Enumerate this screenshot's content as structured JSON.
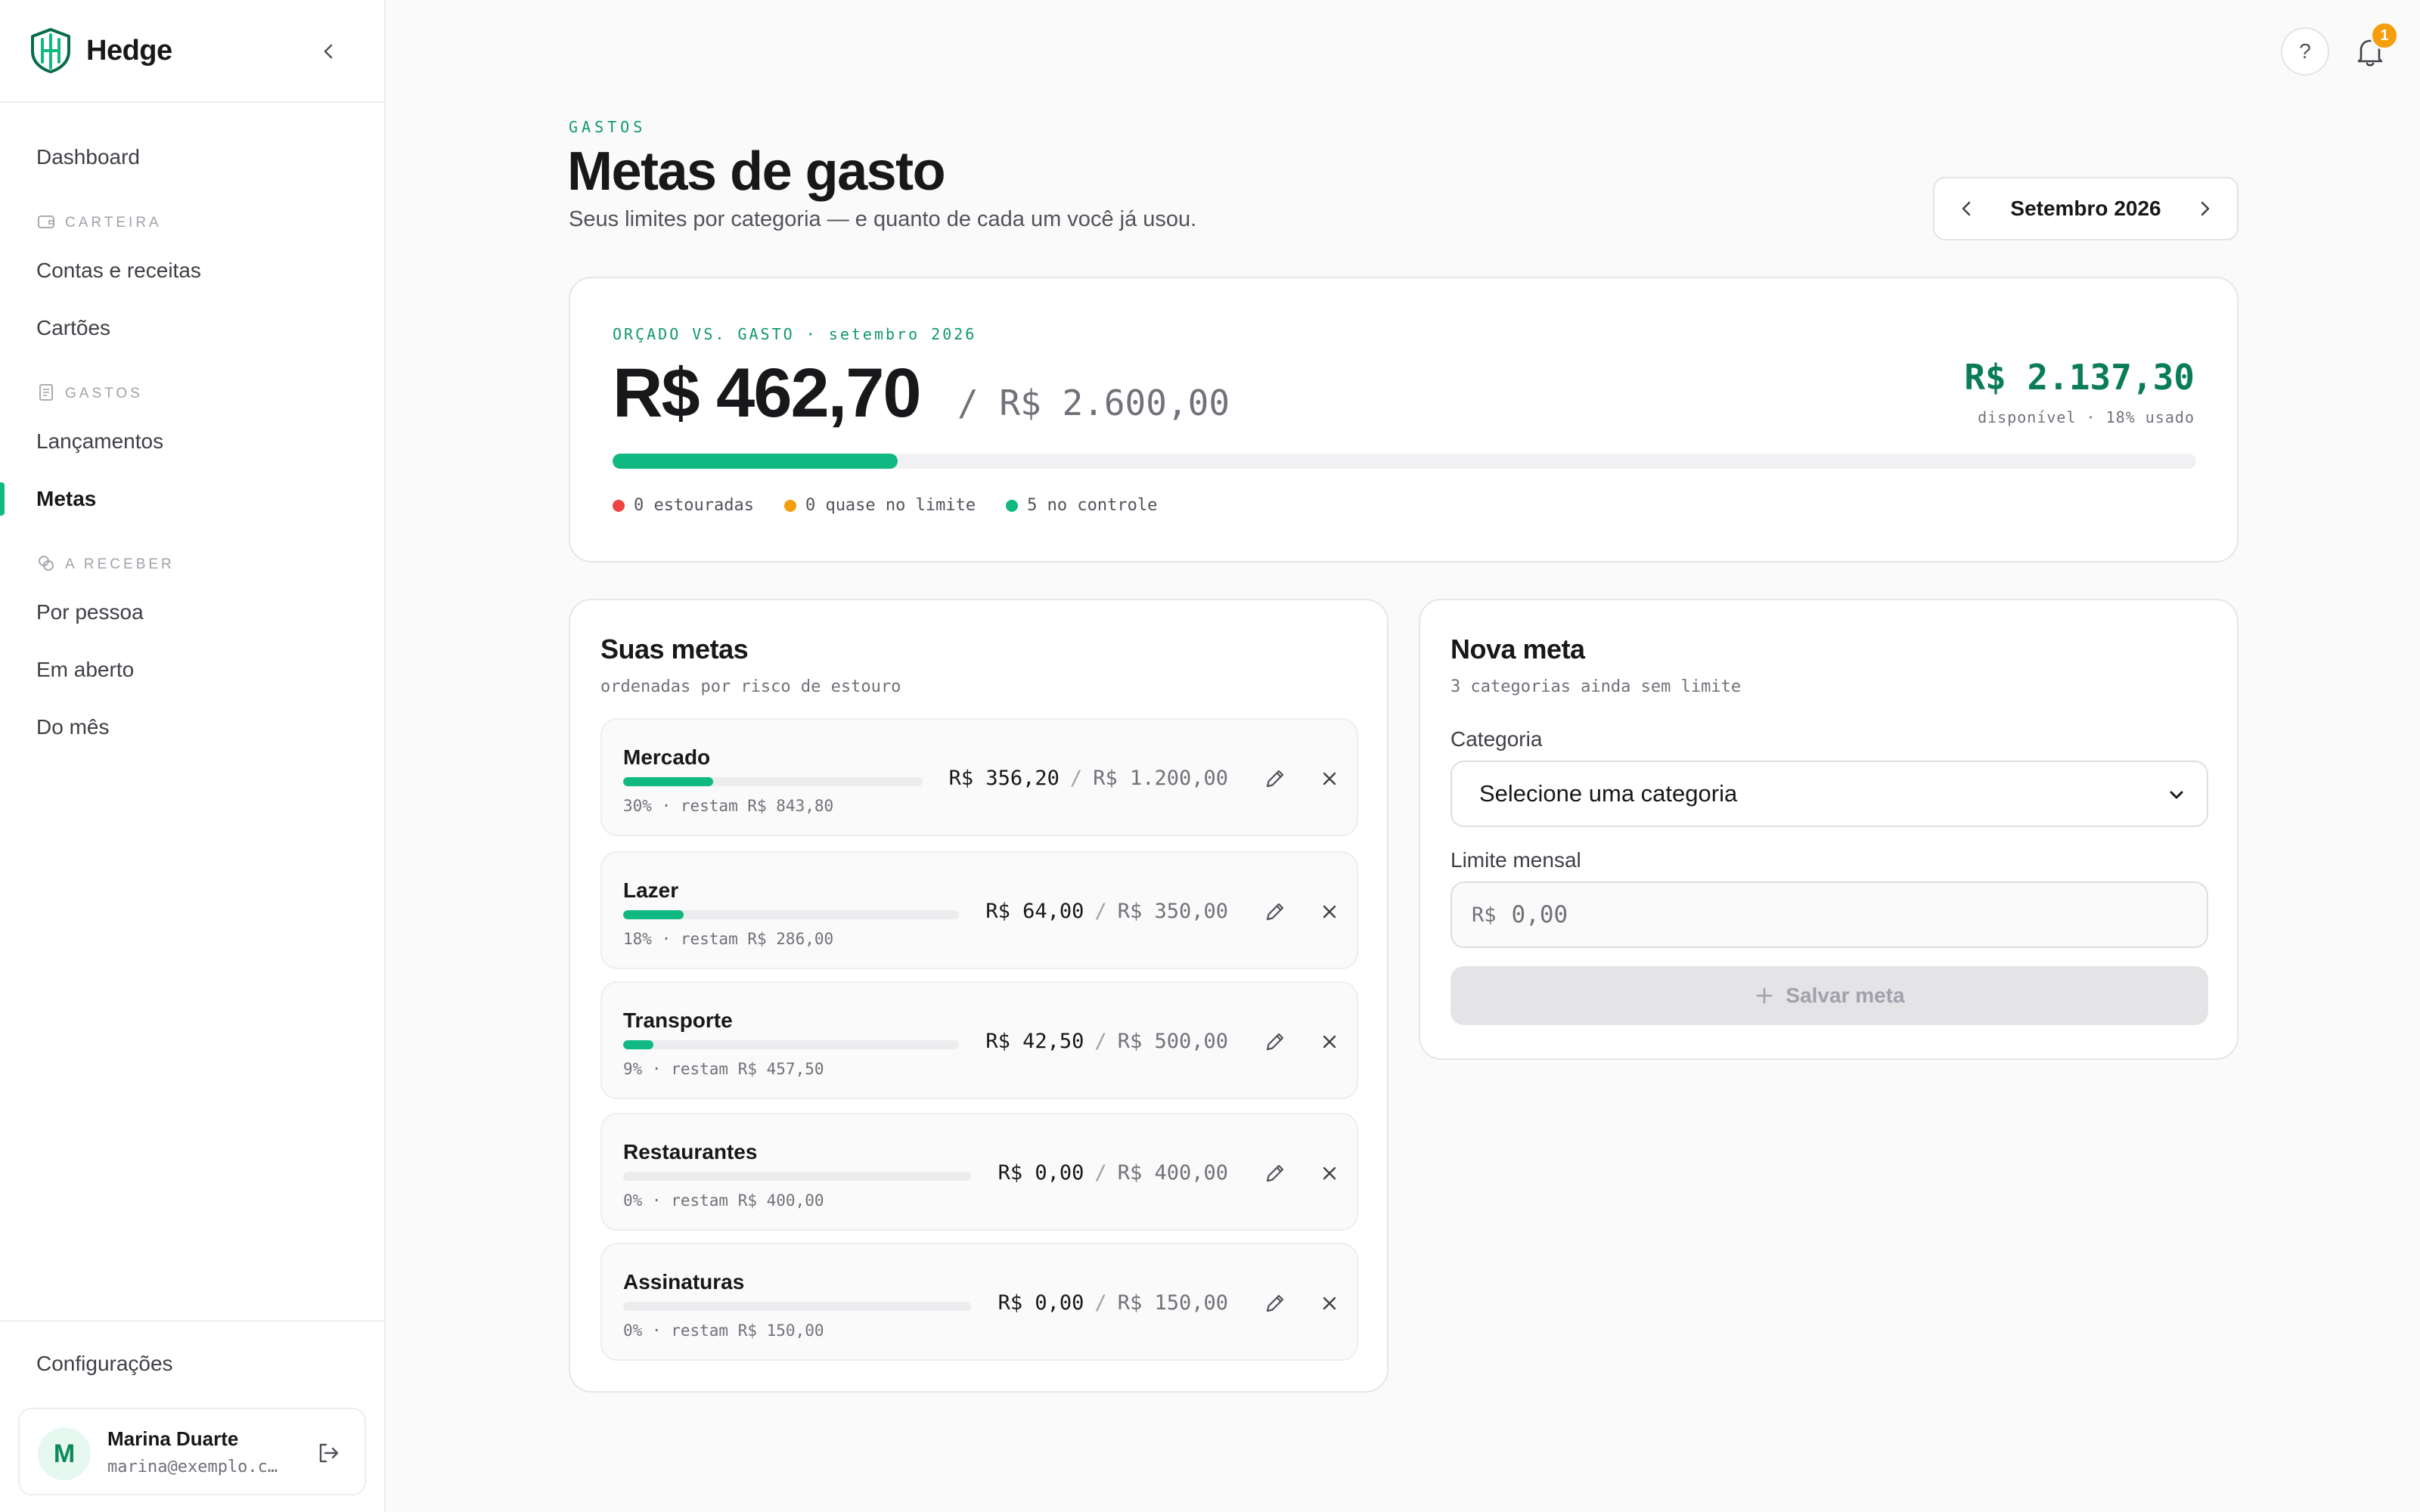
{
  "brand": {
    "name": "Hedge"
  },
  "sidebar": {
    "dashboard": "Dashboard",
    "sections": [
      {
        "title": "CARTEIRA",
        "items": [
          "Contas e receitas",
          "Cartões"
        ]
      },
      {
        "title": "GASTOS",
        "items": [
          "Lançamentos",
          "Metas"
        ]
      },
      {
        "title": "A RECEBER",
        "items": [
          "Por pessoa",
          "Em aberto",
          "Do mês"
        ]
      }
    ],
    "active_item": "Metas",
    "settings": "Configurações",
    "user": {
      "initial": "M",
      "name": "Marina Duarte",
      "email": "marina@exemplo.c…"
    }
  },
  "topbar": {
    "help": "?",
    "notification_count": "1"
  },
  "header": {
    "eyebrow": "GASTOS",
    "title": "Metas de gasto",
    "subtitle": "Seus limites por categoria — e quanto de cada um você já usou.",
    "month": "Setembro 2026"
  },
  "summary": {
    "eyebrow": "ORÇADO VS. GASTO · setembro 2026",
    "spent": "R$ 462,70",
    "budget": "/ R$ 2.600,00",
    "available": "R$ 2.137,30",
    "available_note": "disponível · 18% usado",
    "used_fraction": 0.18,
    "statuses": [
      {
        "label": "0 estouradas",
        "color": "#ef4444"
      },
      {
        "label": "0 quase no limite",
        "color": "#f59e0b"
      },
      {
        "label": "5 no controle",
        "color": "#10b981"
      }
    ]
  },
  "goals": {
    "title": "Suas metas",
    "subtitle": "ordenadas por risco de estouro",
    "items": [
      {
        "name": "Mercado",
        "spent": "R$ 356,20",
        "limit": "R$ 1.200,00",
        "meta": "30% · restam R$ 843,80",
        "fraction": 0.3
      },
      {
        "name": "Lazer",
        "spent": "R$ 64,00",
        "limit": "R$ 350,00",
        "meta": "18% · restam R$ 286,00",
        "fraction": 0.18
      },
      {
        "name": "Transporte",
        "spent": "R$ 42,50",
        "limit": "R$ 500,00",
        "meta": "9% · restam R$ 457,50",
        "fraction": 0.09
      },
      {
        "name": "Restaurantes",
        "spent": "R$ 0,00",
        "limit": "R$ 400,00",
        "meta": "0% · restam R$ 400,00",
        "fraction": 0
      },
      {
        "name": "Assinaturas",
        "spent": "R$ 0,00",
        "limit": "R$ 150,00",
        "meta": "0% · restam R$ 150,00",
        "fraction": 0
      }
    ]
  },
  "new_goal": {
    "title": "Nova meta",
    "subtitle": "3 categorias ainda sem limite",
    "category_label": "Categoria",
    "category_value": "Selecione uma categoria",
    "limit_label": "Limite mensal",
    "currency_prefix": "R$",
    "limit_placeholder": "0,00",
    "save_label": "Salvar meta"
  },
  "colors": {
    "accent": "#10b981",
    "accent_dark": "#0a7d55"
  }
}
